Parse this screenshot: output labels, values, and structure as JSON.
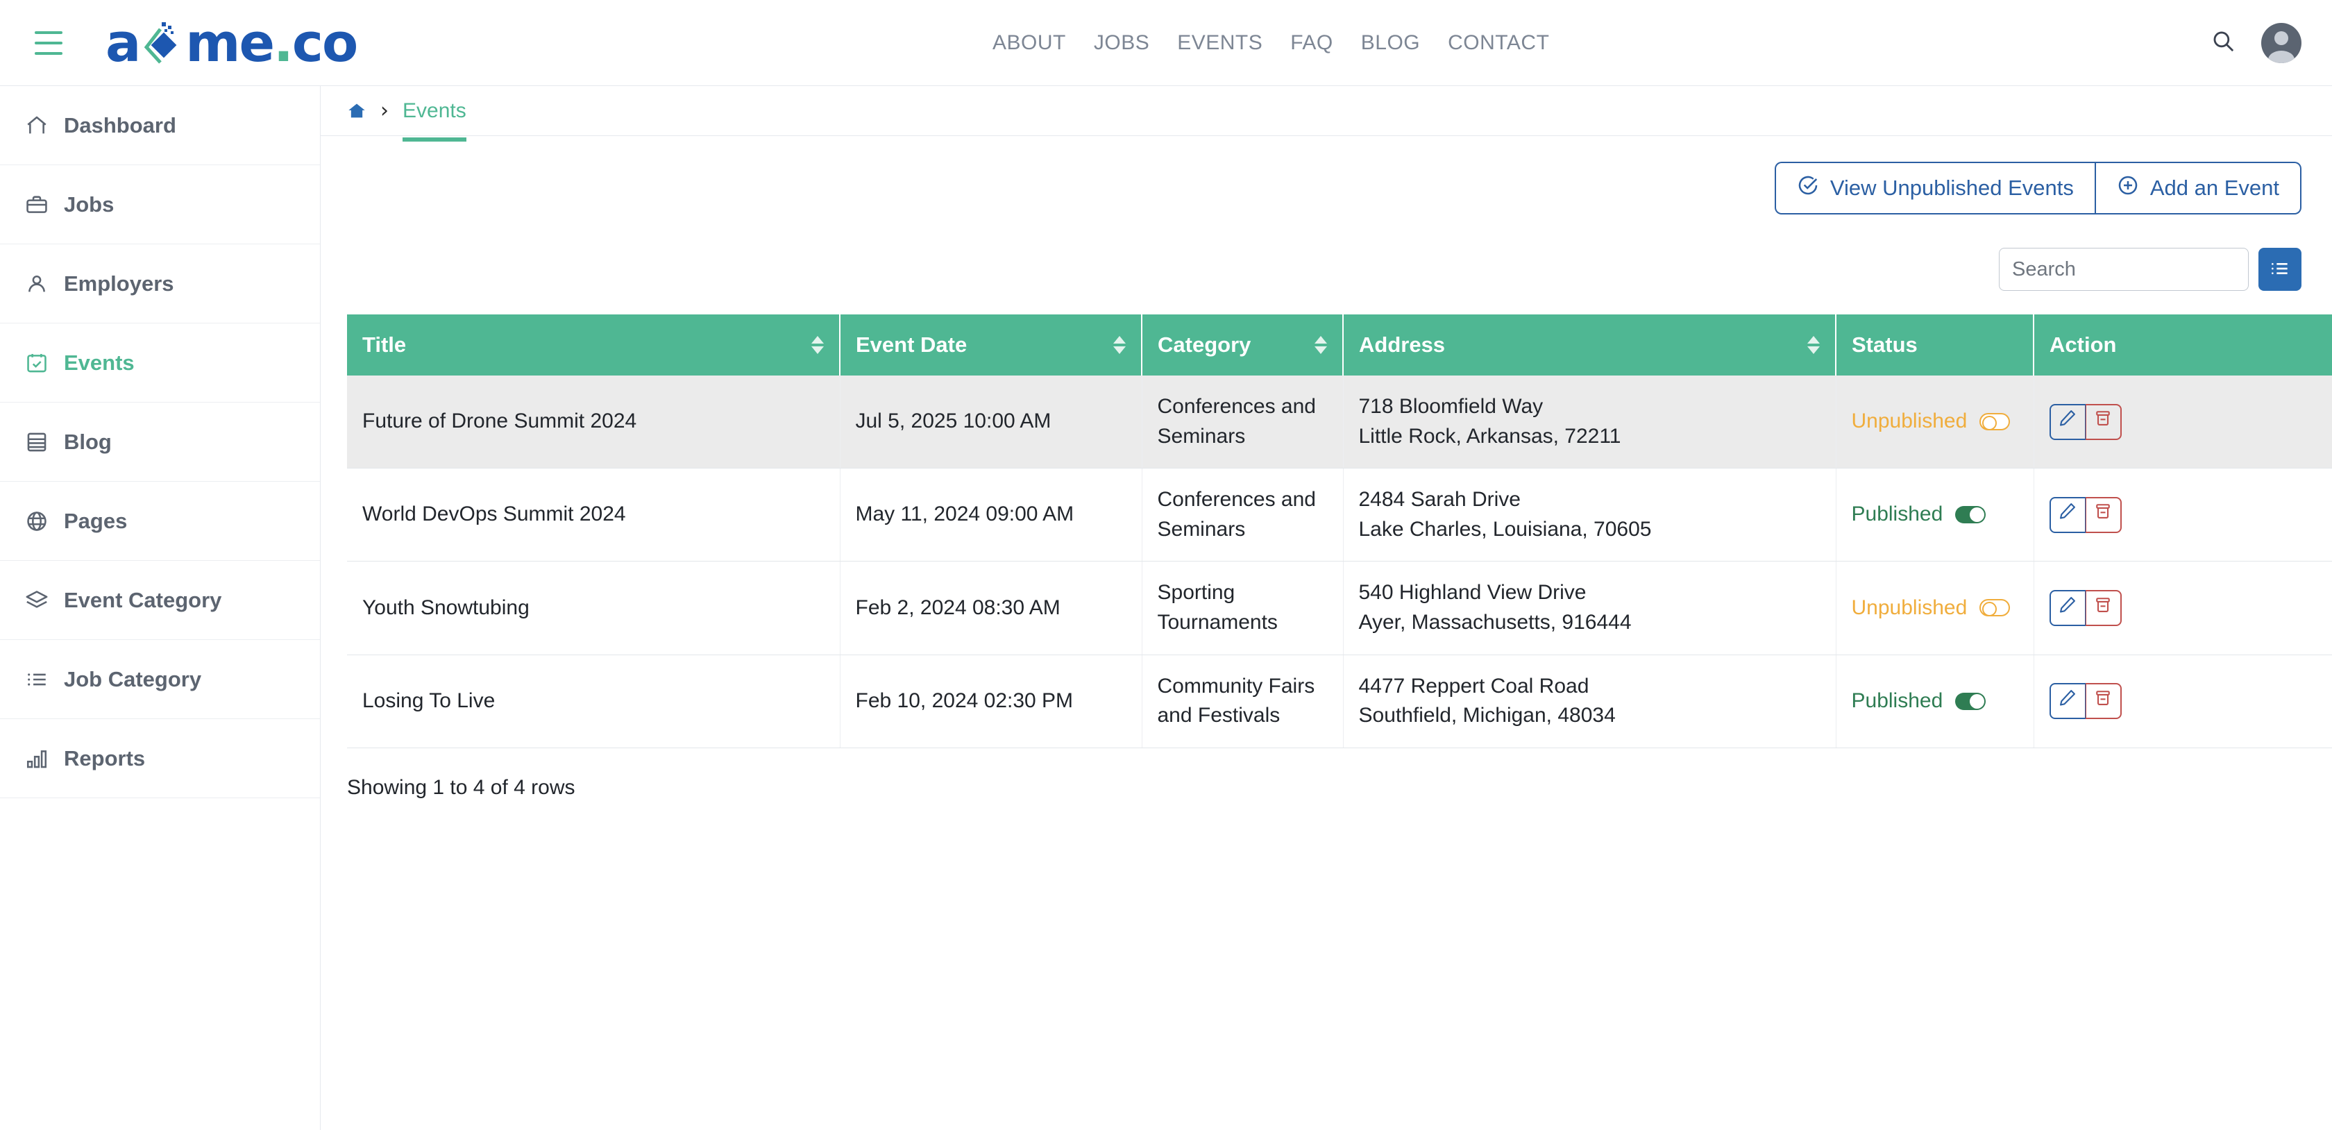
{
  "header": {
    "menu_icon": "hamburger-icon",
    "logo_text_before": "a",
    "logo_mark": "diamond-logo-mark",
    "logo_text_after": "me",
    "logo_dot": ".",
    "logo_text_end": "co",
    "nav": [
      {
        "label": "ABOUT"
      },
      {
        "label": "JOBS"
      },
      {
        "label": "EVENTS"
      },
      {
        "label": "FAQ"
      },
      {
        "label": "BLOG"
      },
      {
        "label": "CONTACT"
      }
    ],
    "search_icon": "search-icon",
    "avatar": "user-avatar"
  },
  "sidebar": {
    "items": [
      {
        "label": "Dashboard",
        "icon": "home-icon",
        "active": false
      },
      {
        "label": "Jobs",
        "icon": "briefcase-icon",
        "active": false
      },
      {
        "label": "Employers",
        "icon": "user-icon",
        "active": false
      },
      {
        "label": "Events",
        "icon": "calendar-check-icon",
        "active": true
      },
      {
        "label": "Blog",
        "icon": "table-rows-icon",
        "active": false
      },
      {
        "label": "Pages",
        "icon": "globe-icon",
        "active": false
      },
      {
        "label": "Event Category",
        "icon": "layers-icon",
        "active": false
      },
      {
        "label": "Job Category",
        "icon": "list-icon",
        "active": false
      },
      {
        "label": "Reports",
        "icon": "bar-chart-icon",
        "active": false
      }
    ]
  },
  "breadcrumb": {
    "home_icon": "home-icon",
    "separator": "›",
    "current": "Events"
  },
  "toolbar": {
    "view_unpublished_label": "View Unpublished Events",
    "view_unpublished_icon": "check-circle-icon",
    "add_event_label": "Add an Event",
    "add_event_icon": "plus-circle-icon"
  },
  "search": {
    "placeholder": "Search",
    "value": "",
    "list_toggle_icon": "list-view-icon"
  },
  "table": {
    "columns": [
      {
        "label": "Title",
        "sortable": true
      },
      {
        "label": "Event Date",
        "sortable": true
      },
      {
        "label": "Category",
        "sortable": true
      },
      {
        "label": "Address",
        "sortable": true
      },
      {
        "label": "Status",
        "sortable": false
      },
      {
        "label": "Action",
        "sortable": false
      }
    ],
    "rows": [
      {
        "title": "Future of Drone Summit 2024",
        "event_date": "Jul 5, 2025 10:00 AM",
        "category": "Conferences and Seminars",
        "address_line1": "718 Bloomfield Way",
        "address_line2": "Little Rock, Arkansas, 72211",
        "status": "Unpublished",
        "published": false,
        "highlighted": true
      },
      {
        "title": "World DevOps Summit 2024",
        "event_date": "May 11, 2024 09:00 AM",
        "category": "Conferences and Seminars",
        "address_line1": "2484 Sarah Drive",
        "address_line2": "Lake Charles, Louisiana, 70605",
        "status": "Published",
        "published": true,
        "highlighted": false
      },
      {
        "title": "Youth Snowtubing",
        "event_date": "Feb 2, 2024 08:30 AM",
        "category": "Sporting Tournaments",
        "address_line1": "540 Highland View Drive",
        "address_line2": "Ayer, Massachusetts, 916444",
        "status": "Unpublished",
        "published": false,
        "highlighted": false
      },
      {
        "title": "Losing To Live",
        "event_date": "Feb 10, 2024 02:30 PM",
        "category": "Community Fairs and Festivals",
        "address_line1": "4477 Reppert Coal Road",
        "address_line2": "Southfield, Michigan, 48034",
        "status": "Published",
        "published": true,
        "highlighted": false
      }
    ],
    "row_actions": {
      "edit_icon": "pencil-icon",
      "delete_icon": "trash-icon"
    },
    "footer_text": "Showing 1 to 4 of 4 rows"
  },
  "colors": {
    "brand_green": "#4fb793",
    "brand_blue": "#1d57b0",
    "link_blue": "#2b5fa3",
    "status_published": "#2f7d53",
    "status_unpublished": "#f0ad3c",
    "delete_red": "#c0504d",
    "header_text": "#7d8694"
  }
}
